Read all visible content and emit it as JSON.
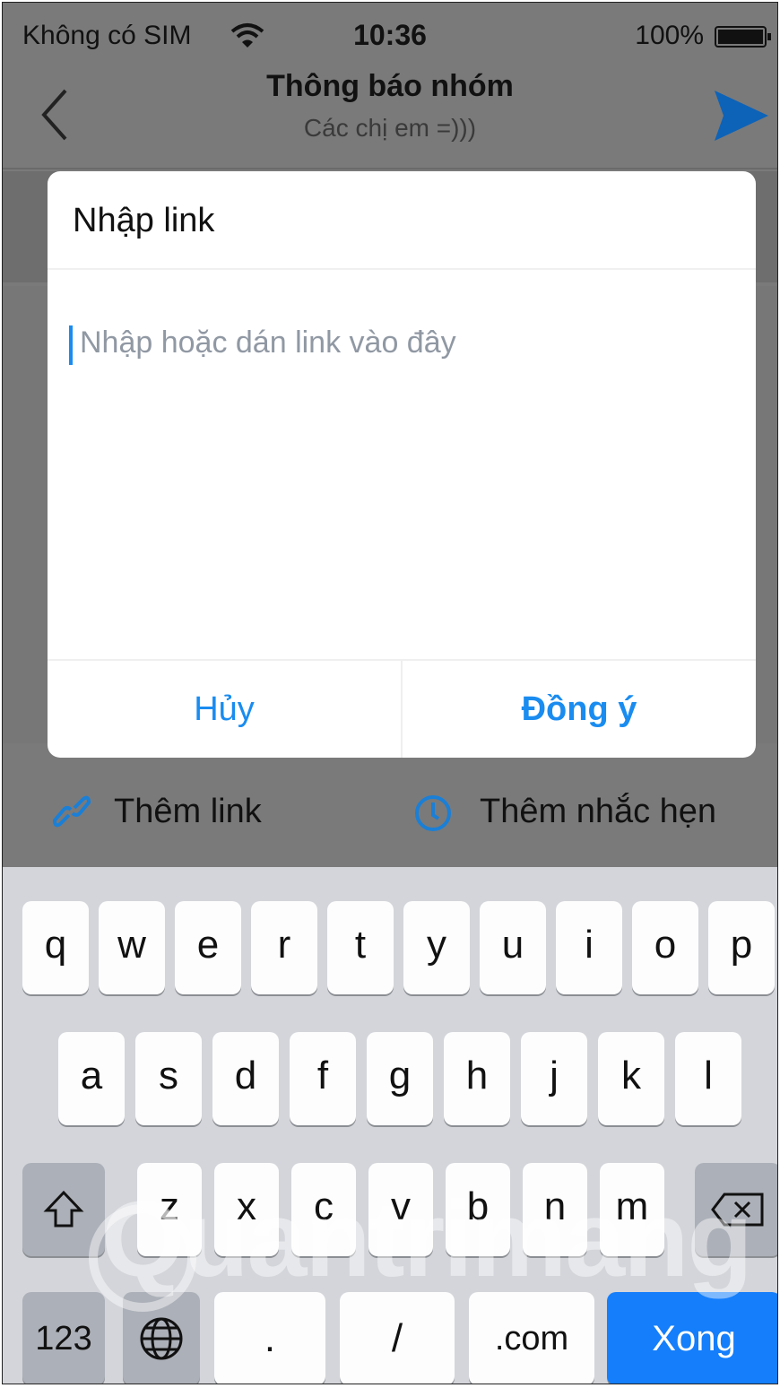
{
  "status_bar": {
    "carrier": "Không có SIM",
    "time": "10:36",
    "battery": "100%"
  },
  "nav": {
    "title": "Thông báo nhóm",
    "subtitle": "Các chị em =)))"
  },
  "dialog": {
    "title": "Nhập link",
    "input_placeholder": "Nhập hoặc dán link vào đây",
    "cancel_label": "Hủy",
    "ok_label": "Đồng ý"
  },
  "toolbar": {
    "add_link_label": "Thêm link",
    "add_reminder_label": "Thêm nhắc hẹn"
  },
  "keyboard": {
    "row1": [
      "q",
      "w",
      "e",
      "r",
      "t",
      "y",
      "u",
      "i",
      "o",
      "p"
    ],
    "row2": [
      "a",
      "s",
      "d",
      "f",
      "g",
      "h",
      "j",
      "k",
      "l"
    ],
    "row3": [
      "z",
      "x",
      "c",
      "v",
      "b",
      "n",
      "m"
    ],
    "numbers_label": "123",
    "dot_label": ".",
    "slash_label": "/",
    "dotcom_label": ".com",
    "done_label": "Xong"
  },
  "watermark": "Quantrimang",
  "colors": {
    "accent": "#1a8cf0",
    "done_key": "#147efb",
    "overlay": "#7a7a7a"
  }
}
